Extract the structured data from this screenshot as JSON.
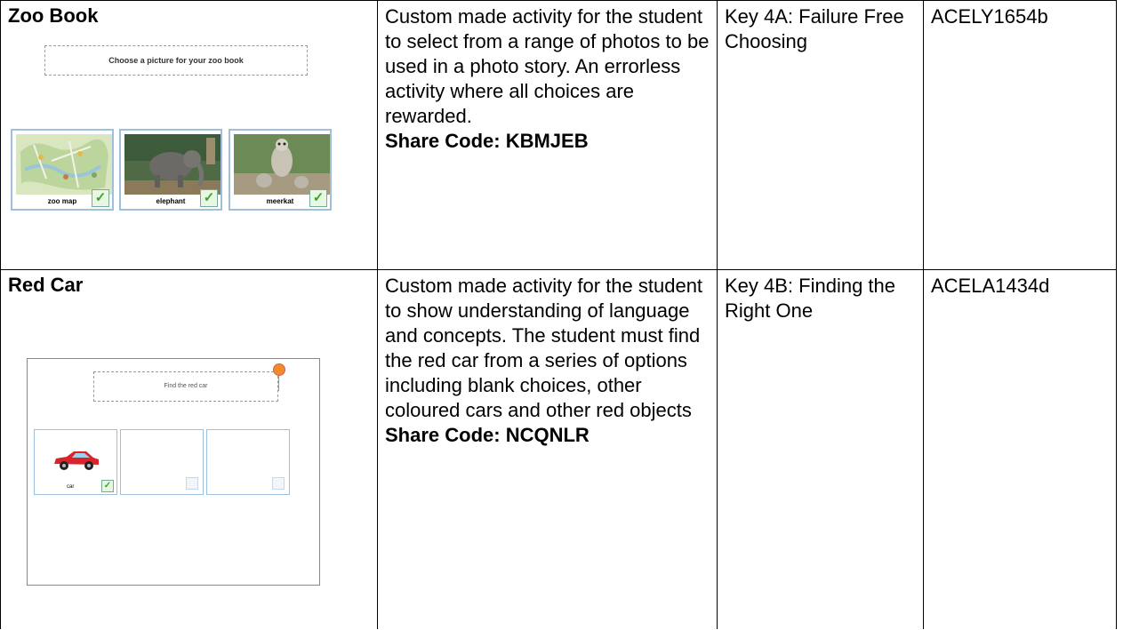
{
  "rows": [
    {
      "title": "Zoo Book",
      "description": "Custom made activity for the student to select from a range of photos to be used in a photo story. An errorless activity where all choices are rewarded.",
      "share_code": "Share Code: KBMJEB",
      "key": "Key 4A: Failure Free Choosing",
      "code": "ACELY1654b",
      "thumbnail": {
        "prompt": "Choose a picture for your zoo book",
        "tiles": [
          "zoo map",
          "elephant",
          "meerkat"
        ]
      }
    },
    {
      "title": "Red Car",
      "description": "Custom made activity for the student to show understanding of language and concepts. The student must find the red car from a series of options including blank choices, other coloured cars and other red objects",
      "share_code": "Share Code: NCQNLR",
      "key": "Key 4B: Finding the Right One",
      "code": "ACELA1434d",
      "thumbnail": {
        "prompt": "Find the red car",
        "tile_label": "car"
      }
    }
  ],
  "colors": {
    "tick": "#3aa42a",
    "tile_border": "#9ec0df",
    "record_button": "#f08a2a",
    "car": "#d9252a"
  }
}
